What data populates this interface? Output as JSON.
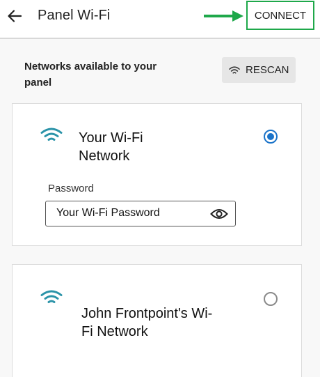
{
  "header": {
    "title": "Panel Wi-Fi",
    "connect_label": "CONNECT"
  },
  "section": {
    "label": "Networks available to your panel",
    "rescan_label": "RESCAN"
  },
  "networks": [
    {
      "name": "Your Wi-Fi Network",
      "selected": true,
      "password_label": "Password",
      "password_value": "Your Wi-Fi Password"
    },
    {
      "name": "John Frontpoint's Wi-Fi Network",
      "selected": false
    }
  ],
  "icons": {
    "back": "arrow-back-icon",
    "annotation": "green-arrow-icon",
    "rescan": "wifi-icon",
    "network": "wifi-icon",
    "password_visibility": "eye-icon"
  },
  "colors": {
    "accent_green": "#1ea84a",
    "radio_blue": "#1a73c9",
    "wifi_teal": "#2a93a8"
  }
}
